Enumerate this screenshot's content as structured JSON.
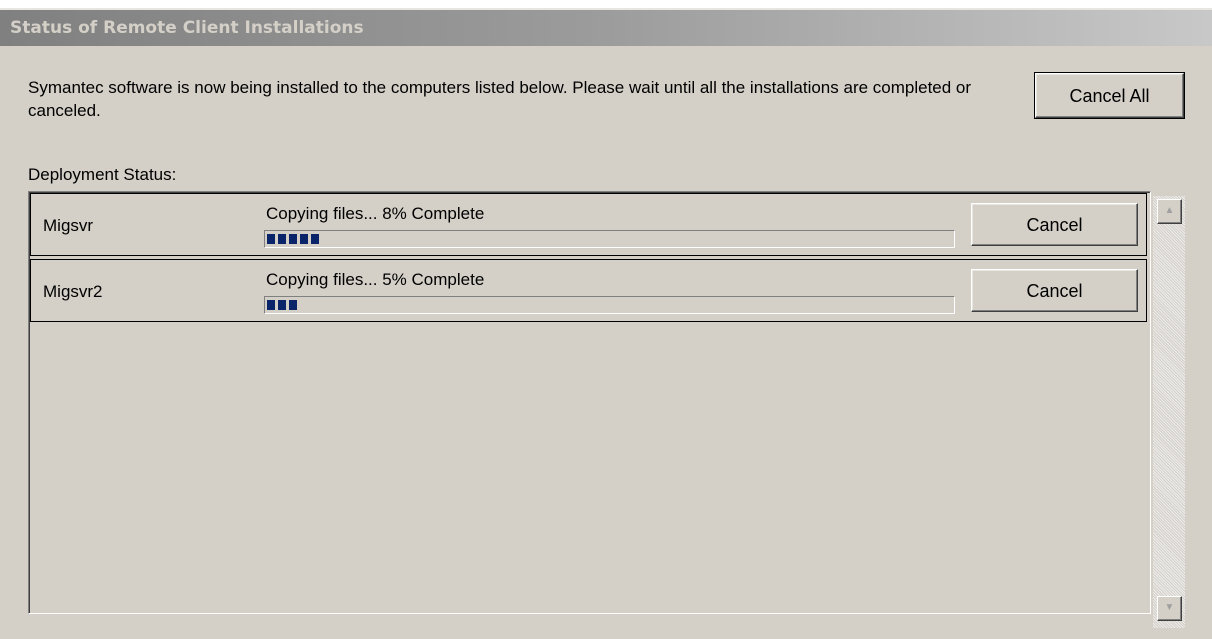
{
  "window": {
    "title": "Status of Remote Client Installations"
  },
  "intro": {
    "text": "Symantec software is now being installed to the computers listed below. Please wait until all the installations are completed or canceled."
  },
  "cancel_all_label": "Cancel All",
  "deployment_label": "Deployment Status:",
  "rows": [
    {
      "computer": "Migsvr",
      "status": "Copying files... 8% Complete",
      "progress_percent": 8,
      "cancel_label": "Cancel"
    },
    {
      "computer": "Migsvr2",
      "status": "Copying files... 5% Complete",
      "progress_percent": 5,
      "cancel_label": "Cancel"
    }
  ],
  "scrollbar": {
    "up_icon": "▲",
    "down_icon": "▼"
  },
  "colors": {
    "dialog_bg": "#d4d0c8",
    "progress_fill": "#0a246a"
  }
}
